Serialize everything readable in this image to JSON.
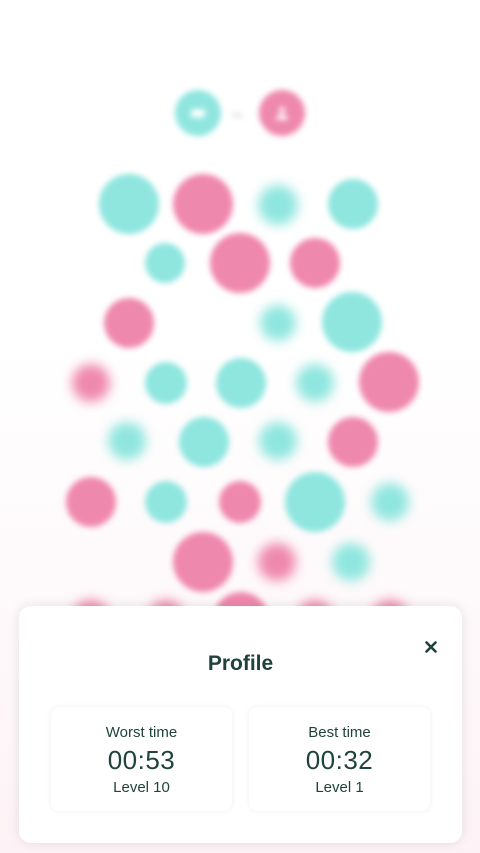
{
  "players": {
    "left_icon": "game-controller-icon",
    "right_icon": "person-icon",
    "vs_label": "vs"
  },
  "colors": {
    "teal": "#8fe6df",
    "pink": "#ef88ad",
    "text": "#20423c"
  },
  "profile": {
    "title": "Profile",
    "close_icon": "close-icon",
    "worst": {
      "label": "Worst time",
      "time": "00:53",
      "level": "Level 10"
    },
    "best": {
      "label": "Best time",
      "time": "00:32",
      "level": "Level 1"
    }
  }
}
